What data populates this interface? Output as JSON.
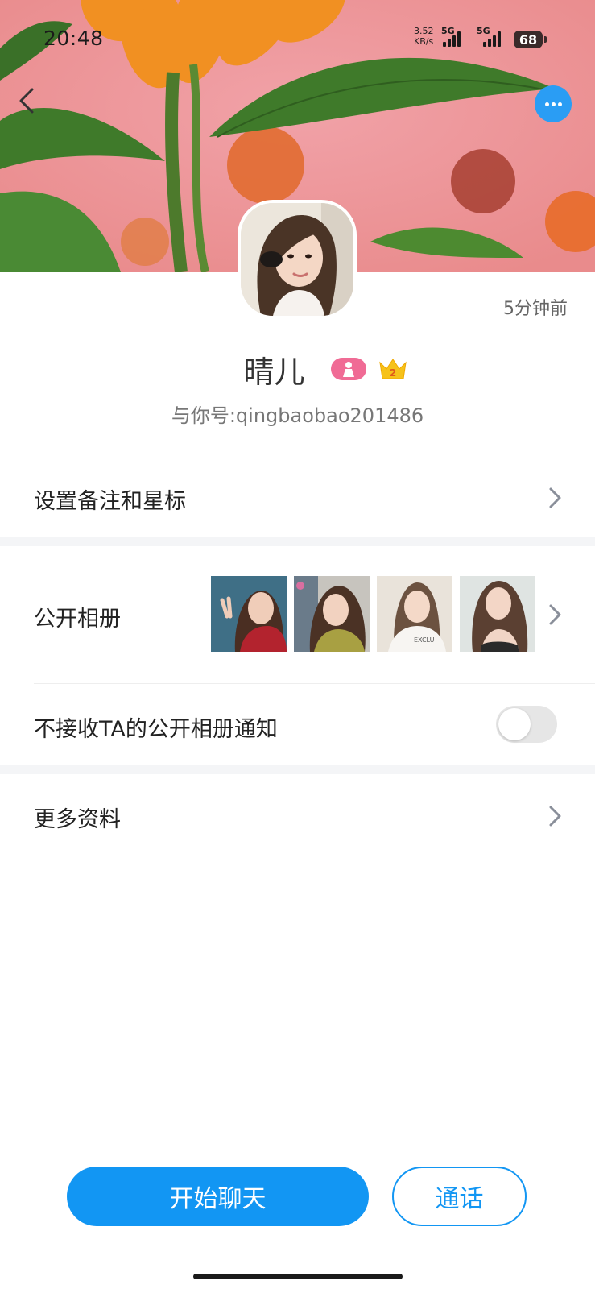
{
  "status_bar": {
    "time": "20:48",
    "net_speed_value": "3.52",
    "net_speed_unit": "KB/s",
    "sim1_label": "5G",
    "sim2_label": "5G",
    "battery": "68"
  },
  "header": {
    "back_icon": "chevron-left-icon",
    "more_icon": "more-dots-icon",
    "accent_color": "#2a9df4"
  },
  "profile": {
    "last_seen": "5分钟前",
    "name": "晴儿",
    "gender_badge_icon": "female-person-icon",
    "vip_level": "2",
    "account": "与你号:qingbaobao201486"
  },
  "menu": {
    "remark": "设置备注和星标",
    "album": "公开相册",
    "album_photo_count_shown": 4,
    "mute_album": "不接收TA的公开相册通知",
    "mute_album_enabled": false,
    "more_info": "更多资料"
  },
  "actions": {
    "chat": "开始聊天",
    "call": "通话",
    "primary_color": "#1296f3"
  }
}
